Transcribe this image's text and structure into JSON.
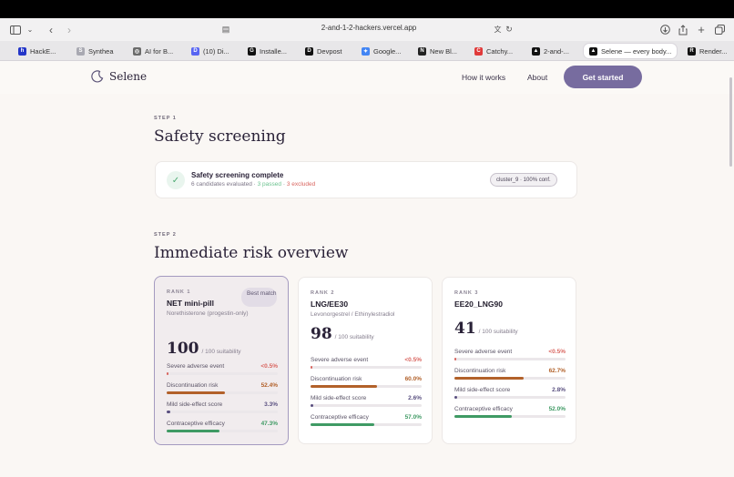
{
  "browser": {
    "url": "2-and-1-2-hackers.vercel.app",
    "tabs": [
      {
        "label": "HackE...",
        "color": "#2436c8",
        "glyph": "h"
      },
      {
        "label": "Synthea",
        "color": "#a9a9b2",
        "glyph": "S"
      },
      {
        "label": "AI for B...",
        "color": "#6b6b6b",
        "glyph": "◎"
      },
      {
        "label": "(10) Di...",
        "color": "#5865f2",
        "glyph": "D"
      },
      {
        "label": "Installe...",
        "color": "#111111",
        "glyph": "G"
      },
      {
        "label": "Devpost",
        "color": "#111111",
        "glyph": "D"
      },
      {
        "label": "Google...",
        "color": "#4285f4",
        "glyph": "✦"
      },
      {
        "label": "New Bl...",
        "color": "#222222",
        "glyph": "N"
      },
      {
        "label": "Catchy...",
        "color": "#e03a3a",
        "glyph": "C"
      },
      {
        "label": "2-and-...",
        "color": "#111111",
        "glyph": "▲"
      },
      {
        "label": "Selene — every body...",
        "color": "#111111",
        "glyph": "▲"
      },
      {
        "label": "Render...",
        "color": "#111111",
        "glyph": "R"
      }
    ]
  },
  "site": {
    "brand": "Selene",
    "nav": {
      "how": "How it works",
      "about": "About",
      "cta": "Get started"
    }
  },
  "step1": {
    "label": "STEP 1",
    "title": "Safety screening",
    "card_title": "Safety screening complete",
    "sub_prefix": "6 candidates evaluated · ",
    "sub_passed": "3 passed",
    "sub_sep": " · ",
    "sub_excluded": "3 excluded",
    "badge": "cluster_9 · 100% conf."
  },
  "step2": {
    "label": "STEP 2",
    "title": "Immediate risk overview",
    "score_unit": "/ 100 suitability",
    "best_badge": "Best match",
    "metric_labels": [
      "Severe adverse event",
      "Discontinuation risk",
      "Mild side-effect score",
      "Contraceptive efficacy"
    ],
    "metric_colors": [
      "#d9655f",
      "#b2612a",
      "#5a5080",
      "#3f9a64"
    ],
    "cards": [
      {
        "rank": "RANK 1",
        "name": "NET mini-pill",
        "sub": "Norethisterone (progestin-only)",
        "score": "100",
        "metrics": [
          {
            "v": "<0.5%",
            "f": 0.005
          },
          {
            "v": "52.4%",
            "f": 0.524
          },
          {
            "v": "3.3%",
            "f": 0.033
          },
          {
            "v": "47.3%",
            "f": 0.473
          }
        ]
      },
      {
        "rank": "RANK 2",
        "name": "LNG/EE30",
        "sub": "Levonorgestrel / Ethinylestradiol",
        "score": "98",
        "metrics": [
          {
            "v": "<0.5%",
            "f": 0.005
          },
          {
            "v": "60.0%",
            "f": 0.6
          },
          {
            "v": "2.6%",
            "f": 0.026
          },
          {
            "v": "57.0%",
            "f": 0.57
          }
        ]
      },
      {
        "rank": "RANK 3",
        "name": "EE20_LNG90",
        "sub": "",
        "score": "41",
        "metrics": [
          {
            "v": "<0.5%",
            "f": 0.005
          },
          {
            "v": "62.7%",
            "f": 0.627
          },
          {
            "v": "2.8%",
            "f": 0.028
          },
          {
            "v": "52.0%",
            "f": 0.52
          }
        ]
      }
    ]
  }
}
